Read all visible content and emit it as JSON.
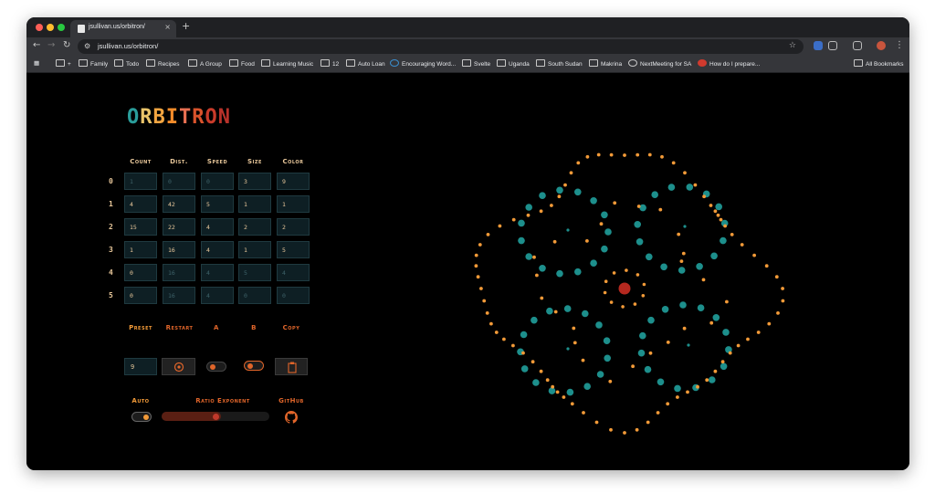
{
  "browser": {
    "tab_title": "jsullivan.us/orbitron/",
    "url": "jsullivan.us/orbitron/",
    "new_tab_label": "+",
    "tab_close_label": "×",
    "bookmarks": [
      {
        "label": "+"
      },
      {
        "label": "Family"
      },
      {
        "label": "Todo"
      },
      {
        "label": "Recipes"
      },
      {
        "label": "A Group"
      },
      {
        "label": "Food"
      },
      {
        "label": "Learning Music"
      },
      {
        "label": "12"
      },
      {
        "label": "Auto Loan"
      },
      {
        "label": "Encouraging Word..."
      },
      {
        "label": "Svelte"
      },
      {
        "label": "Uganda"
      },
      {
        "label": "South Sudan"
      },
      {
        "label": "Makrina"
      },
      {
        "label": "NextMeeting for SA"
      },
      {
        "label": "How do I prepare..."
      }
    ],
    "all_bookmarks": "All Bookmarks"
  },
  "app": {
    "logo_letters": [
      "O",
      "R",
      "B",
      "I",
      "T",
      "R",
      "O",
      "N"
    ],
    "logo_colors": [
      "#2a9d9a",
      "#e9c46a",
      "#f2a541",
      "#f48c2a",
      "#e76f51",
      "#d9532c",
      "#c93b2a",
      "#b8322a"
    ],
    "headers": [
      "Count",
      "Dist.",
      "Speed",
      "Size",
      "Color"
    ],
    "rows": [
      {
        "label": "0",
        "values": [
          "1",
          "0",
          "0",
          "3",
          "9"
        ],
        "active": [
          false,
          false,
          false,
          true,
          true
        ]
      },
      {
        "label": "1",
        "values": [
          "4",
          "42",
          "5",
          "1",
          "1"
        ],
        "active": [
          true,
          true,
          true,
          true,
          true
        ]
      },
      {
        "label": "2",
        "values": [
          "15",
          "22",
          "4",
          "2",
          "2"
        ],
        "active": [
          true,
          true,
          true,
          true,
          true
        ]
      },
      {
        "label": "3",
        "values": [
          "1",
          "16",
          "4",
          "1",
          "5"
        ],
        "active": [
          true,
          true,
          true,
          true,
          true
        ]
      },
      {
        "label": "4",
        "values": [
          "0",
          "16",
          "4",
          "5",
          "4"
        ],
        "active": [
          true,
          false,
          false,
          false,
          false
        ]
      },
      {
        "label": "5",
        "values": [
          "0",
          "16",
          "4",
          "0",
          "0"
        ],
        "active": [
          true,
          false,
          false,
          false,
          false
        ]
      }
    ],
    "controls": {
      "preset_label": "Preset",
      "preset_value": "9",
      "restart_label": "Restart",
      "a_label": "A",
      "b_label": "B",
      "copy_label": "Copy",
      "auto_label": "Auto",
      "ratio_label": "Ratio Exponent",
      "ratio_value": 0.55,
      "github_label": "GitHub",
      "a_on": false,
      "b_on": true,
      "auto_on": true
    },
    "colors": {
      "teal": "#1d8f8c",
      "orange": "#f29a38",
      "red": "#b5281f",
      "cream": "#e8c79a",
      "accent": "#e0652a"
    }
  }
}
